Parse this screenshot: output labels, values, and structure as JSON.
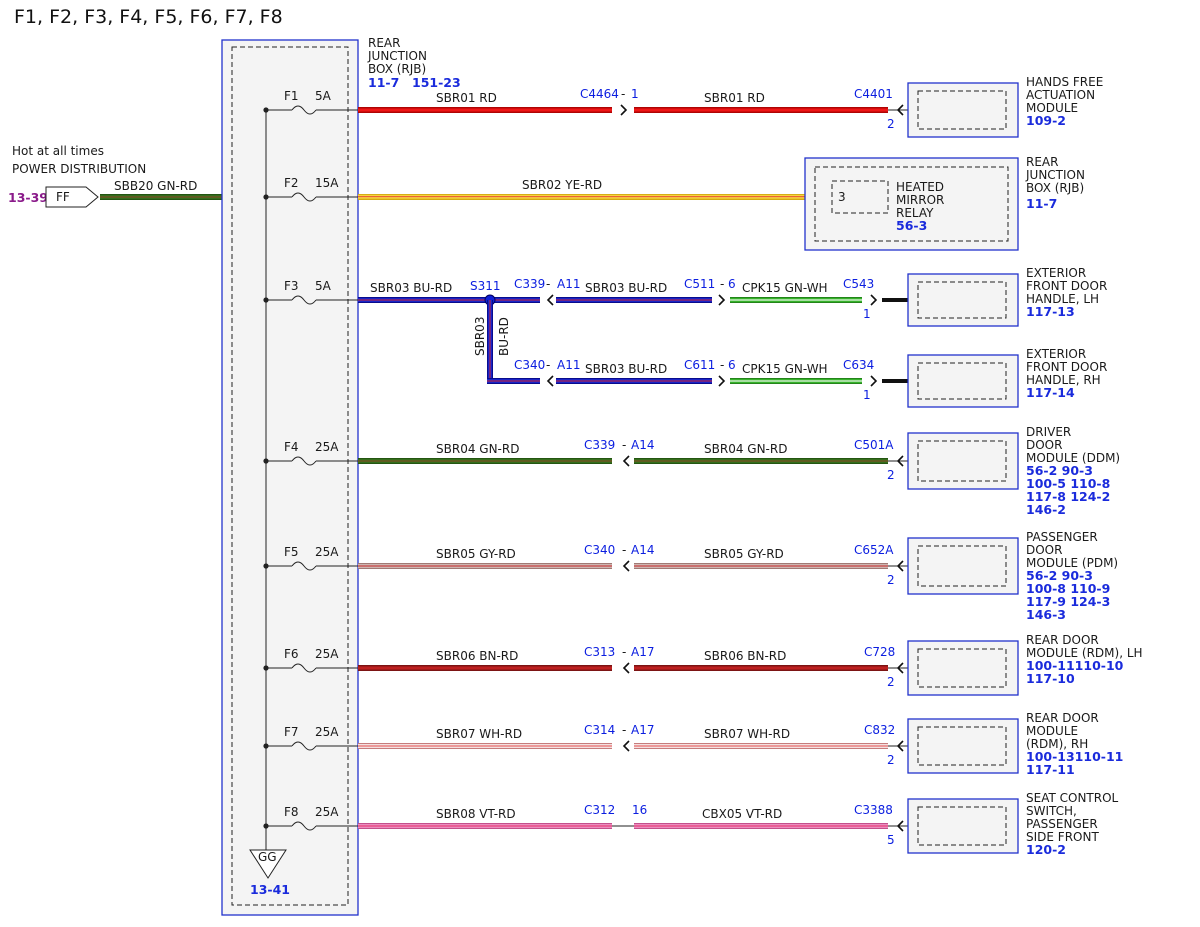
{
  "title": "F1, F2, F3, F4, F5, F6, F7, F8",
  "colors": {
    "box_border": "#2233cc",
    "ref_blue": "#1a2bdc",
    "connector_blue": "#0b1ee0",
    "ref_purple": "#8a1a8a"
  },
  "source": {
    "line1": "Hot at all times",
    "line2": "POWER DISTRIBUTION",
    "ref": "13-39",
    "connector": "FF",
    "wire": "SBB20  GN-RD"
  },
  "rjb": {
    "label": [
      "REAR",
      "JUNCTION",
      "BOX (RJB)"
    ],
    "ref1": "11-7",
    "ref2": "151-23",
    "ground": "GG",
    "ground_ref": "13-41"
  },
  "fuses": [
    {
      "name": "F1",
      "rating": "5A"
    },
    {
      "name": "F2",
      "rating": "15A"
    },
    {
      "name": "F3",
      "rating": "5A"
    },
    {
      "name": "F4",
      "rating": "25A"
    },
    {
      "name": "F5",
      "rating": "25A"
    },
    {
      "name": "F6",
      "rating": "25A"
    },
    {
      "name": "F7",
      "rating": "25A"
    },
    {
      "name": "F8",
      "rating": "25A"
    }
  ],
  "circuits": [
    {
      "wire1": "SBR01  RD",
      "conn": "C4464",
      "sep": "-",
      "pin": "1",
      "wire2": "SBR01  RD",
      "end_conn": "C4401",
      "end_pin": "2",
      "module": [
        "HANDS FREE",
        "ACTUATION",
        "MODULE"
      ],
      "refs": [
        "109-2"
      ]
    },
    {
      "wire1": "SBR02  YE-RD",
      "end_pin": "3",
      "module": [
        "REAR",
        "JUNCTION",
        "BOX (RJB)"
      ],
      "refs": [
        "11-7"
      ],
      "inner": [
        "HEATED",
        "MIRROR",
        "RELAY"
      ],
      "inner_ref": "56-3"
    },
    {
      "wire1": "SBR03  BU-RD",
      "splice": "S311",
      "conn": "C339",
      "sep": "-",
      "pin": "A11",
      "wire2": "SBR03  BU-RD",
      "conn2": "C511",
      "sep2": "-",
      "pin2": "6",
      "wire3": "CPK15  GN-WH",
      "end_conn": "C543",
      "end_pin": "1",
      "module": [
        "EXTERIOR",
        "FRONT DOOR",
        "HANDLE, LH"
      ],
      "refs": [
        "117-13"
      ]
    },
    {
      "vert_wire": [
        "SBR03",
        "BU-RD"
      ],
      "conn": "C340",
      "sep": "-",
      "pin": "A11",
      "wire2": "SBR03  BU-RD",
      "conn2": "C611",
      "sep2": "-",
      "pin2": "6",
      "wire3": "CPK15  GN-WH",
      "end_conn": "C634",
      "end_pin": "1",
      "module": [
        "EXTERIOR",
        "FRONT DOOR",
        "HANDLE, RH"
      ],
      "refs": [
        "117-14"
      ]
    },
    {
      "wire1": "SBR04  GN-RD",
      "conn": "C339",
      "sep": "-",
      "pin": "A14",
      "wire2": "SBR04  GN-RD",
      "end_conn": "C501A",
      "end_pin": "2",
      "module": [
        "DRIVER",
        "DOOR",
        "MODULE (DDM)"
      ],
      "refs": [
        "56-2  90-3",
        "100-5 110-8",
        "117-8 124-2",
        "146-2"
      ]
    },
    {
      "wire1": "SBR05  GY-RD",
      "conn": "C340",
      "sep": "-",
      "pin": "A14",
      "wire2": "SBR05  GY-RD",
      "end_conn": "C652A",
      "end_pin": "2",
      "module": [
        "PASSENGER",
        "DOOR",
        "MODULE (PDM)"
      ],
      "refs": [
        "56-2  90-3",
        "100-8 110-9",
        "117-9 124-3",
        "146-3"
      ]
    },
    {
      "wire1": "SBR06  BN-RD",
      "conn": "C313",
      "sep": "-",
      "pin": "A17",
      "wire2": "SBR06  BN-RD",
      "end_conn": "C728",
      "end_pin": "2",
      "module": [
        "REAR DOOR",
        "MODULE (RDM), LH"
      ],
      "refs": [
        "100-11110-10",
        "117-10"
      ]
    },
    {
      "wire1": "SBR07  WH-RD",
      "conn": "C314",
      "sep": "-",
      "pin": "A17",
      "wire2": "SBR07  WH-RD",
      "end_conn": "C832",
      "end_pin": "2",
      "module": [
        "REAR DOOR",
        "MODULE",
        "(RDM), RH"
      ],
      "refs": [
        "100-13110-11",
        "117-11"
      ]
    },
    {
      "wire1": "SBR08  VT-RD",
      "conn": "C312",
      "sep": "",
      "pin": "16",
      "wire2": "CBX05  VT-RD",
      "end_conn": "C3388",
      "end_pin": "5",
      "module": [
        "SEAT CONTROL",
        "SWITCH,",
        "PASSENGER",
        "SIDE FRONT"
      ],
      "refs": [
        "120-2"
      ]
    }
  ]
}
